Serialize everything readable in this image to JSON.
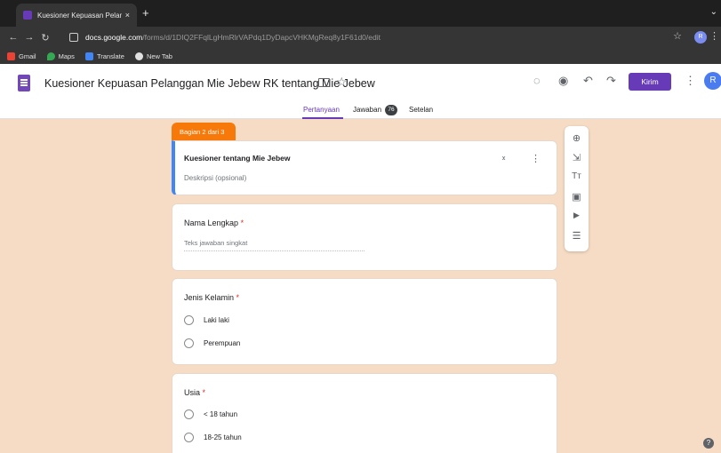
{
  "browser": {
    "tab_title": "Kuesioner Kepuasan Pelangg...",
    "tab_close": "×",
    "new_tab": "+",
    "tab_menu": "⌄",
    "nav": {
      "back": "←",
      "forward": "→",
      "reload": "↻"
    },
    "url_host": "docs.google.com",
    "url_path": "/forms/d/1DIQ2FFqlLgHmRlrVAPdq1DyDapcVHKMgReq8y1F61d0/edit",
    "star": "☆",
    "profile_initial": "R",
    "menu": "⋮",
    "bookmarks": [
      {
        "label": "Gmail",
        "color": "#ea4335"
      },
      {
        "label": "Maps",
        "color": "#34a853"
      },
      {
        "label": "Translate",
        "color": "#4285f4"
      },
      {
        "label": "New Tab",
        "color": "#e0e0e0"
      }
    ]
  },
  "forms_header": {
    "title": "Kuesioner Kepuasan Pelanggan Mie Jebew RK tentang Mie Jebew",
    "star": "☆",
    "palette": "◌",
    "preview": "◉",
    "undo": "↶",
    "redo": "↷",
    "send_label": "Kirim",
    "menu": "⋮",
    "avatar_initial": "R"
  },
  "form_tabs": {
    "questions": "Pertanyaan",
    "responses": "Jawaban",
    "responses_count": "76",
    "settings": "Setelan"
  },
  "section": {
    "tab_label": "Bagian 2 dari 3",
    "title": "Kuesioner tentang Mie Jebew",
    "description_placeholder": "Deskripsi (opsional)",
    "collapse": "⌄\n⌃",
    "menu": "⋮"
  },
  "questions": [
    {
      "title": "Nama Lengkap",
      "required_mark": "*",
      "answer_placeholder": "Teks jawaban singkat"
    },
    {
      "title": "Jenis Kelamin",
      "required_mark": "*",
      "options": [
        "Laki laki",
        "Perempuan"
      ]
    },
    {
      "title": "Usia",
      "required_mark": "*",
      "options": [
        "< 18 tahun",
        "18-25 tahun"
      ]
    }
  ],
  "side_toolbar": {
    "add_question": "⊕",
    "import_questions": "⇲",
    "add_title": "Tт",
    "add_image": "▣",
    "add_video": "▶",
    "add_section": "☰"
  },
  "help": "?",
  "colors": {
    "accent": "#673ab7",
    "section_tab": "#f7790a",
    "background": "#f6dcc4",
    "section_bar": "#4285f4"
  }
}
